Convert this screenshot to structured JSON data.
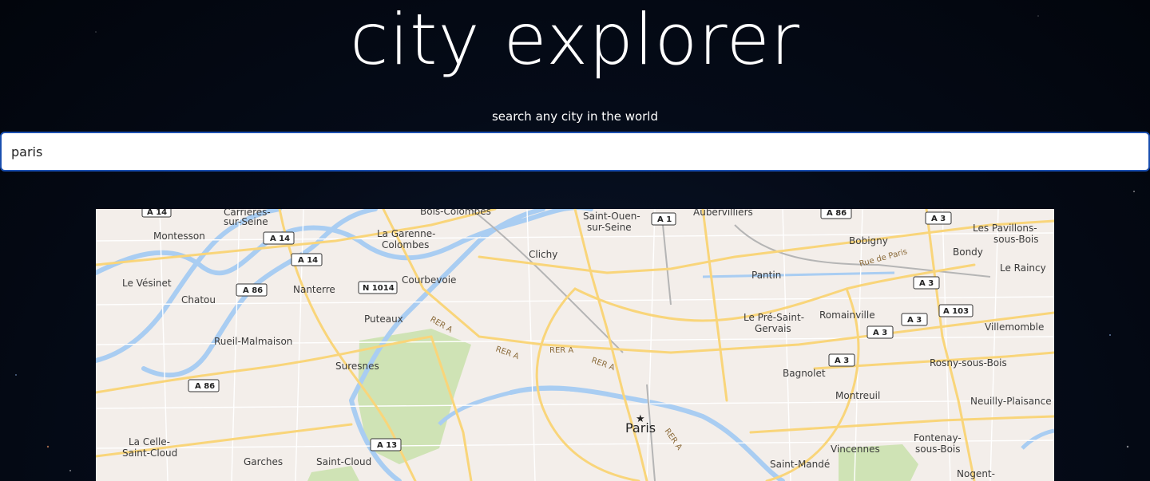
{
  "header": {
    "title": "city explorer",
    "subtitle": "search any city in the world"
  },
  "search": {
    "value": "paris",
    "placeholder": ""
  },
  "map": {
    "place_labels": [
      {
        "id": "carrieres",
        "text": "Carrières-"
      },
      {
        "id": "sur-seine",
        "text": "sur-Seine"
      },
      {
        "id": "bois-colombes",
        "text": "Bois-Colombes"
      },
      {
        "id": "saint-ouen",
        "text": "Saint-Ouen-"
      },
      {
        "id": "saint-ouen-2",
        "text": "sur-Seine"
      },
      {
        "id": "aubervilliers",
        "text": "Aubervilliers"
      },
      {
        "id": "montesson",
        "text": "Montesson"
      },
      {
        "id": "la-garenne",
        "text": "La Garenne-"
      },
      {
        "id": "colombes",
        "text": "Colombes"
      },
      {
        "id": "bobigny",
        "text": "Bobigny"
      },
      {
        "id": "les-pavillons",
        "text": "Les Pavillons-"
      },
      {
        "id": "sous-bois",
        "text": "sous-Bois"
      },
      {
        "id": "bondy",
        "text": "Bondy"
      },
      {
        "id": "clichy",
        "text": "Clichy"
      },
      {
        "id": "le-raincy",
        "text": "Le Raincy"
      },
      {
        "id": "le-vesinet",
        "text": "Le Vésinet"
      },
      {
        "id": "nanterre",
        "text": "Nanterre"
      },
      {
        "id": "courbevoie",
        "text": "Courbevoie"
      },
      {
        "id": "pantin",
        "text": "Pantin"
      },
      {
        "id": "chatou",
        "text": "Chatou"
      },
      {
        "id": "romainville",
        "text": "Romainville"
      },
      {
        "id": "le-pre",
        "text": "Le Pré-Saint-"
      },
      {
        "id": "gervais",
        "text": "Gervais"
      },
      {
        "id": "puteaux",
        "text": "Puteaux"
      },
      {
        "id": "villemomble",
        "text": "Villemomble"
      },
      {
        "id": "rueil",
        "text": "Rueil-Malmaison"
      },
      {
        "id": "suresnes",
        "text": "Suresnes"
      },
      {
        "id": "bagnolet",
        "text": "Bagnolet"
      },
      {
        "id": "rosny",
        "text": "Rosny-sous-Bois"
      },
      {
        "id": "montreuil",
        "text": "Montreuil"
      },
      {
        "id": "neuilly-plaisance",
        "text": "Neuilly-Plaisance"
      },
      {
        "id": "paris",
        "text": "Paris"
      },
      {
        "id": "la-celle",
        "text": "La Celle-"
      },
      {
        "id": "saint-cloud-2",
        "text": "Saint-Cloud"
      },
      {
        "id": "fontenay",
        "text": "Fontenay-"
      },
      {
        "id": "fontenay-2",
        "text": "sous-Bois"
      },
      {
        "id": "vincennes",
        "text": "Vincennes"
      },
      {
        "id": "garches",
        "text": "Garches"
      },
      {
        "id": "saint-cloud",
        "text": "Saint-Cloud"
      },
      {
        "id": "saint-mande",
        "text": "Saint-Mandé"
      },
      {
        "id": "nogent",
        "text": "Nogent-"
      }
    ],
    "road_shields": [
      "A 14",
      "A 14",
      "A 14",
      "A 1",
      "A 86",
      "A 3",
      "A 86",
      "N 1014",
      "A 3",
      "A 103",
      "A 3",
      "A 3",
      "A 3",
      "A 86",
      "A 13"
    ],
    "rer_labels": [
      "RER A",
      "RER A",
      "RER A",
      "RER A",
      "RER A"
    ],
    "street_labels": [
      "Rue de Paris"
    ],
    "colors": {
      "land": "#f3eeea",
      "water": "#a9cdf2",
      "park": "#cfe3b5",
      "major_road": "#f9d57a",
      "minor_road": "#ffffff",
      "rail": "#b5b5b5"
    }
  }
}
